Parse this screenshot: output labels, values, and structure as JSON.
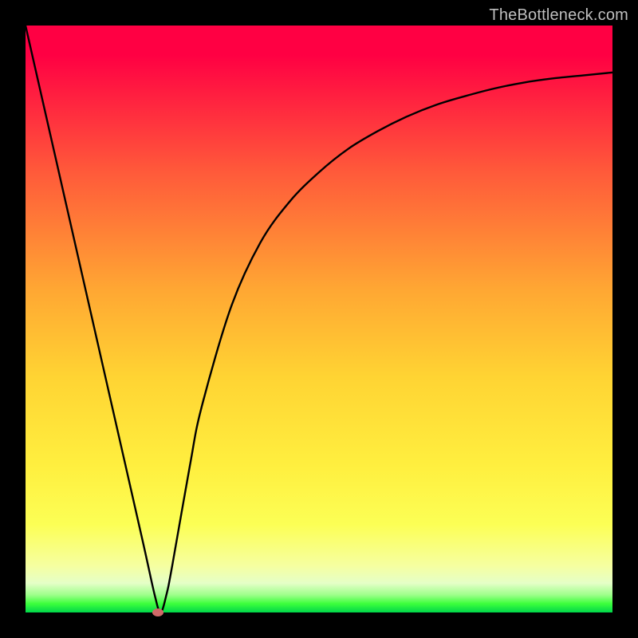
{
  "watermark": "TheBottleneck.com",
  "chart_data": {
    "type": "line",
    "title": "",
    "xlabel": "",
    "ylabel": "",
    "xlim": [
      0,
      100
    ],
    "ylim": [
      0,
      100
    ],
    "grid": false,
    "legend": false,
    "series": [
      {
        "name": "curve",
        "x": [
          0,
          5,
          10,
          15,
          20,
          22,
          23,
          24,
          25,
          28,
          30,
          35,
          40,
          45,
          50,
          55,
          60,
          65,
          70,
          75,
          80,
          85,
          90,
          95,
          100
        ],
        "y": [
          100,
          78,
          56,
          34,
          12,
          3,
          0,
          3,
          8,
          25,
          35,
          52,
          63,
          70,
          75,
          79,
          82,
          84.5,
          86.5,
          88,
          89.3,
          90.3,
          91,
          91.5,
          92
        ]
      }
    ],
    "marker": {
      "x": 22.5,
      "y": 0
    },
    "background_gradient": {
      "top_color": "#ff0043",
      "mid_color": "#ffd433",
      "bottom_color": "#00d64a"
    }
  }
}
